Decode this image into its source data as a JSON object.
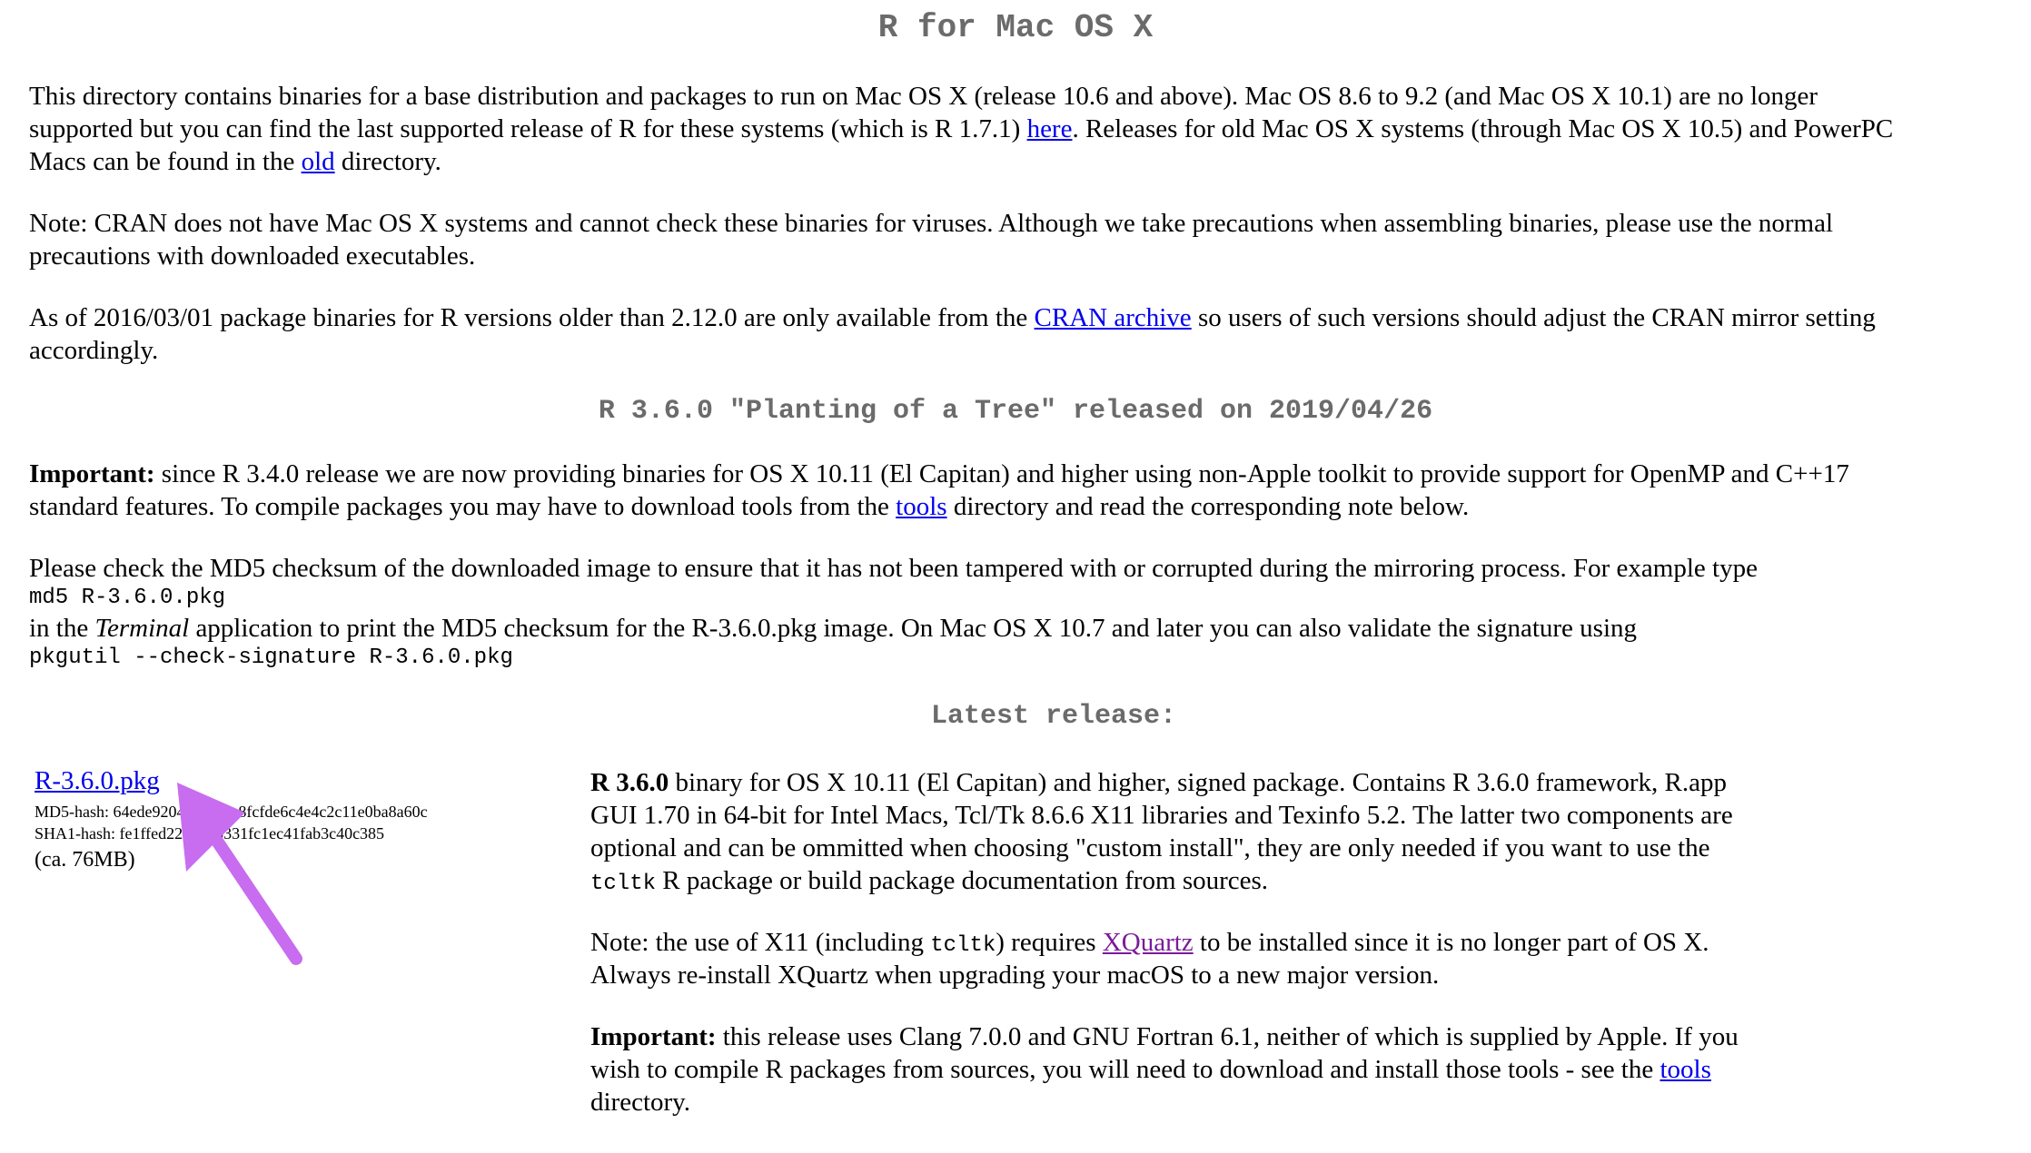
{
  "page": {
    "title": "R for Mac OS X",
    "intro": {
      "l1": "This directory contains binaries for a base distribution and packages to run on Mac OS X (release 10.6 and above). Mac OS 8.6 to 9.2 (and Mac OS X 10.1) are no longer",
      "l2_pre": "supported but you can find the last supported release of R for these systems (which is R 1.7.1) ",
      "l2_link": "here",
      "l2_post": ". Releases for old Mac OS X systems (through Mac OS X 10.5) and PowerPC",
      "l3_pre": "Macs can be found in the ",
      "l3_link": "old",
      "l3_post": " directory."
    },
    "note": {
      "l1": "Note: CRAN does not have Mac OS X systems and cannot check these binaries for viruses. Although we take precautions when assembling binaries, please use the normal",
      "l2": "precautions with downloaded executables."
    },
    "asof": {
      "l1_pre": "As of 2016/03/01 package binaries for R versions older than 2.12.0 are only available from the ",
      "l1_link": "CRAN archive",
      "l1_post": " so users of such versions should adjust the CRAN mirror setting",
      "l2": "accordingly."
    },
    "release_heading": "R 3.6.0 \"Planting of a Tree\" released on 2019/04/26",
    "important": {
      "bold": "Important:",
      "l1": " since R 3.4.0 release we are now providing binaries for OS X 10.11 (El Capitan) and higher using non-Apple toolkit to provide support for OpenMP and C++17",
      "l2_pre": "standard features. To compile packages you may have to download tools from the ",
      "l2_link": "tools",
      "l2_post": " directory and read the corresponding note below."
    },
    "checksum": {
      "l1": "Please check the MD5 checksum of the downloaded image to ensure that it has not been tampered with or corrupted during the mirroring process. For example type",
      "cmd1": "md5 R-3.6.0.pkg",
      "l3_pre": "in the ",
      "l3_italic": "Terminal",
      "l3_post": " application to print the MD5 checksum for the R-3.6.0.pkg image. On Mac OS X 10.7 and later you can also validate the signature using",
      "cmd2": "pkgutil --check-signature R-3.6.0.pkg"
    },
    "latest_heading": "Latest release:",
    "download": {
      "link": "R-3.6.0.pkg",
      "md5": "MD5-hash: 64ede9204b4ecc9c8fcfde6c4e4c2c11e0ba8a60c",
      "sha1": "SHA1-hash: fe1ffed22196db331fc1ec41fab3c40c385",
      "size": "(ca. 76MB)"
    },
    "desc": {
      "p1_bold": "R 3.6.0",
      "p1_l1": " binary for OS X 10.11 (El Capitan) and higher, signed package. Contains R 3.6.0 framework, R.app",
      "p1_l2": "GUI 1.70 in 64-bit for Intel Macs, Tcl/Tk 8.6.6 X11 libraries and Texinfo 5.2. The latter two components are",
      "p1_l3": "optional and can be ommitted when choosing \"custom install\", they are only needed if you want to use the",
      "p1_l4_code": "tcltk",
      "p1_l4_post": " R package or build package documentation from sources.",
      "p2_l1_pre": "Note: the use of X11 (including ",
      "p2_l1_code": "tcltk",
      "p2_l1_mid": ") requires ",
      "p2_l1_link": "XQuartz",
      "p2_l1_post": " to be installed since it is no longer part of OS X.",
      "p2_l2": "Always re-install XQuartz when upgrading your macOS to a new major version.",
      "p3_bold": "Important:",
      "p3_l1": " this release uses Clang 7.0.0 and GNU Fortran 6.1, neither of which is supplied by Apple. If you",
      "p3_l2_pre": "wish to compile R packages from sources, you will need to download and install those tools - see the ",
      "p3_l2_link": "tools",
      "p3_l3": "directory."
    }
  },
  "colors": {
    "link": "#0000ee",
    "visited": "#7a1a9a",
    "heading": "#6b6b6b",
    "arrow": "#c86cf0"
  },
  "icons": {
    "annotation": "arrow-icon"
  }
}
